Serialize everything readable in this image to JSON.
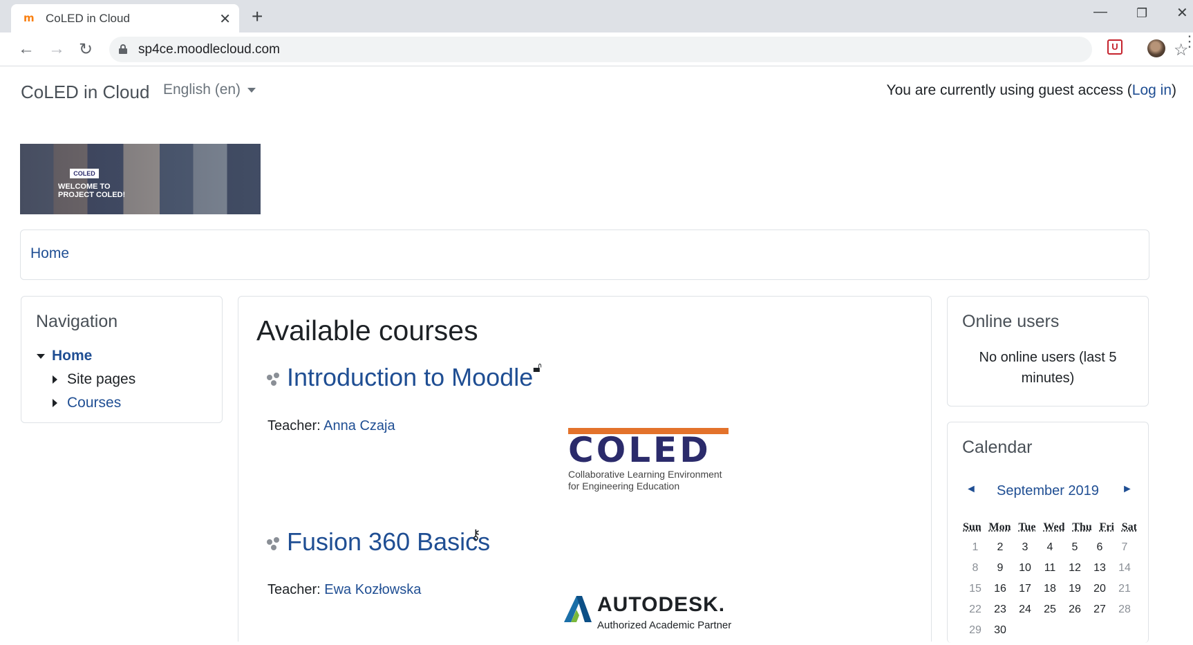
{
  "browser": {
    "tab_title": "CoLED in Cloud",
    "tab_close": "✕",
    "new_tab": "+",
    "url": "sp4ce.moodlecloud.com",
    "favicon_text": "m"
  },
  "header": {
    "site_name": "CoLED in Cloud",
    "language": "English (en)",
    "guest_text": "You are currently using guest access (",
    "login_label": "Log in",
    "guest_close": ")"
  },
  "banner": {
    "logo_text": "COLED",
    "line1": "WELCOME TO",
    "line2": "PROJECT COLED!"
  },
  "breadcrumb": {
    "home": "Home"
  },
  "navigation": {
    "title": "Navigation",
    "home": "Home",
    "items": [
      {
        "label": "Site pages"
      },
      {
        "label": "Courses"
      }
    ]
  },
  "main": {
    "title": "Available courses",
    "courses": [
      {
        "name": "Introduction to Moodle",
        "teacher_label": "Teacher: ",
        "teacher": "Anna Czaja",
        "access_icon": "unlock-icon"
      },
      {
        "name": "Fusion 360 Basics",
        "teacher_label": "Teacher: ",
        "teacher": "Ewa Kozłowska",
        "access_icon": "key-icon"
      }
    ],
    "coled_logo": {
      "word": "COLED",
      "line1": "Collaborative Learning Environment",
      "line2": "for Engineering Education"
    },
    "autodesk_logo": {
      "word": "AUTODESK.",
      "sub": "Authorized Academic Partner"
    }
  },
  "online_users": {
    "title": "Online users",
    "text": "No online users (last 5 minutes)"
  },
  "calendar": {
    "title": "Calendar",
    "prev": "◄",
    "next": "►",
    "month": "September 2019",
    "days": [
      "Sun",
      "Mon",
      "Tue",
      "Wed",
      "Thu",
      "Fri",
      "Sat"
    ],
    "weeks": [
      [
        "1",
        "2",
        "3",
        "4",
        "5",
        "6",
        "7"
      ],
      [
        "8",
        "9",
        "10",
        "11",
        "12",
        "13",
        "14"
      ],
      [
        "15",
        "16",
        "17",
        "18",
        "19",
        "20",
        "21"
      ],
      [
        "22",
        "23",
        "24",
        "25",
        "26",
        "27",
        "28"
      ],
      [
        "29",
        "30",
        "",
        "",
        "",
        "",
        ""
      ]
    ]
  },
  "colors": {
    "link": "#1f4e93",
    "coled_orange": "#e3722b",
    "coled_navy": "#2b2b6b"
  }
}
